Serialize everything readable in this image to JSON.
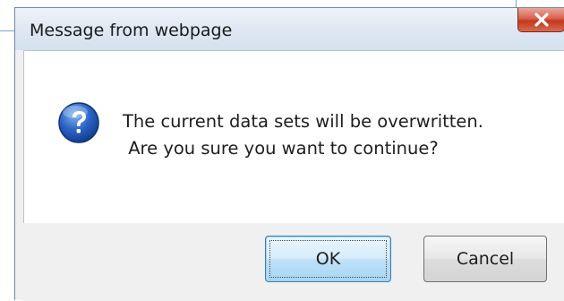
{
  "dialog": {
    "title": "Message from webpage",
    "message_line1": "The current data sets will be overwritten.",
    "message_line2": " Are you sure you want to continue?",
    "icon": "question-icon",
    "buttons": {
      "ok_label": "OK",
      "cancel_label": "Cancel"
    }
  },
  "colors": {
    "close_button": "#d4543c",
    "ok_button": "#bfe1f8",
    "dialog_background": "#f0f0f0"
  }
}
